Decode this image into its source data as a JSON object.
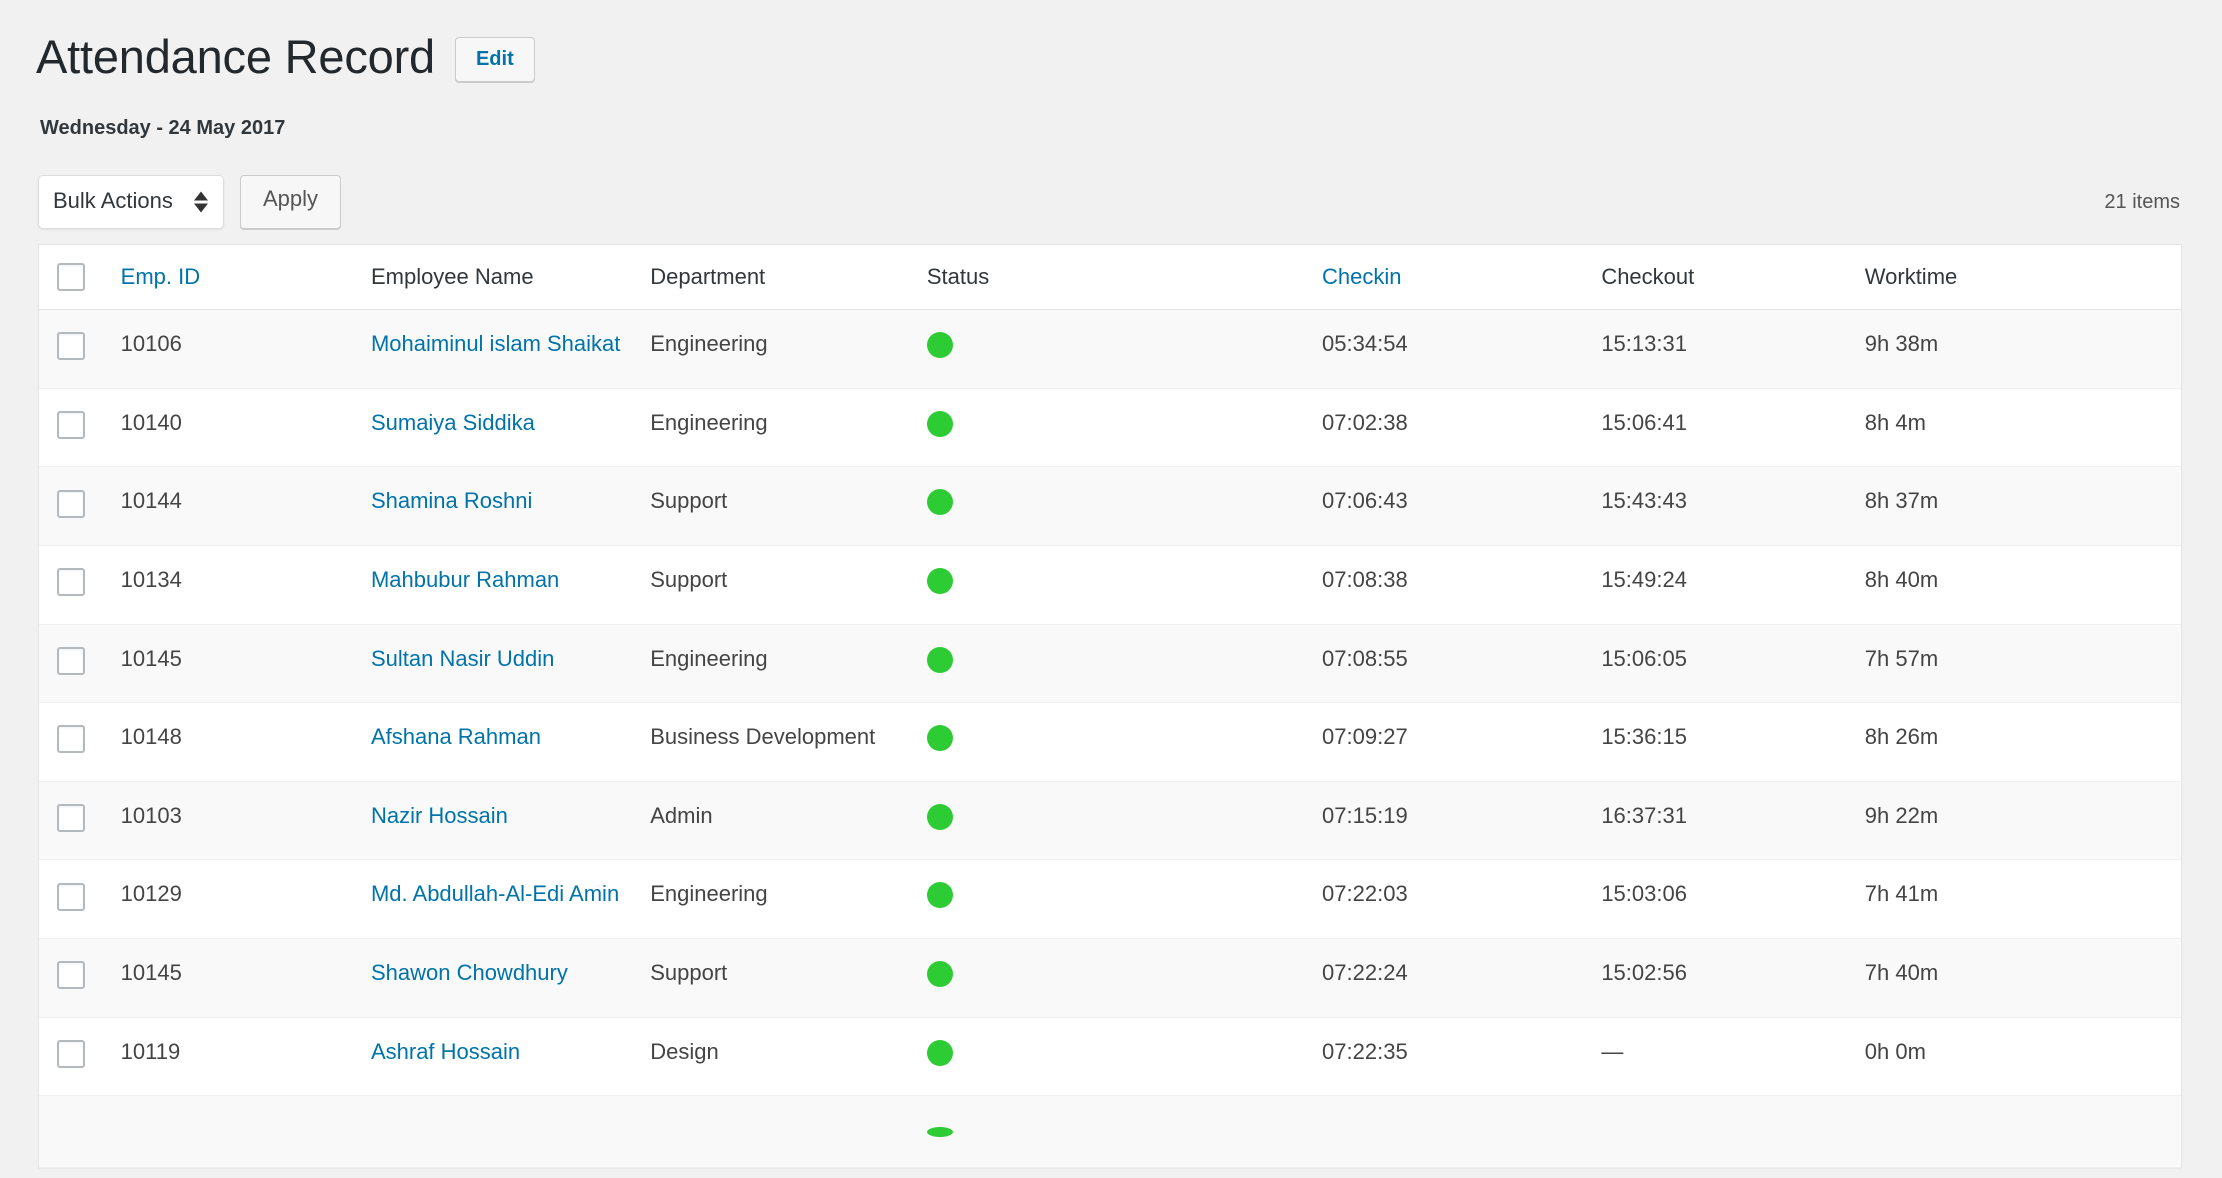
{
  "header": {
    "title": "Attendance Record",
    "edit_label": "Edit",
    "date_line": "Wednesday - 24 May 2017"
  },
  "toolbar": {
    "bulk_actions_label": "Bulk Actions",
    "bulk_actions_options": [
      "Bulk Actions"
    ],
    "apply_label": "Apply",
    "items_count": "21 items"
  },
  "table": {
    "columns": [
      {
        "key": "cb",
        "label": "",
        "link": false
      },
      {
        "key": "id",
        "label": "Emp. ID",
        "link": true
      },
      {
        "key": "name",
        "label": "Employee Name",
        "link": false
      },
      {
        "key": "dept",
        "label": "Department",
        "link": false
      },
      {
        "key": "status",
        "label": "Status",
        "link": false
      },
      {
        "key": "in",
        "label": "Checkin",
        "link": true
      },
      {
        "key": "out",
        "label": "Checkout",
        "link": false
      },
      {
        "key": "work",
        "label": "Worktime",
        "link": false
      }
    ],
    "rows": [
      {
        "id": "10106",
        "name": "Mohaiminul islam Shaikat",
        "dept": "Engineering",
        "status": "present",
        "in": "05:34:54",
        "out": "15:13:31",
        "work": "9h 38m"
      },
      {
        "id": "10140",
        "name": "Sumaiya Siddika",
        "dept": "Engineering",
        "status": "present",
        "in": "07:02:38",
        "out": "15:06:41",
        "work": "8h 4m"
      },
      {
        "id": "10144",
        "name": "Shamina Roshni",
        "dept": "Support",
        "status": "present",
        "in": "07:06:43",
        "out": "15:43:43",
        "work": "8h 37m"
      },
      {
        "id": "10134",
        "name": "Mahbubur Rahman",
        "dept": "Support",
        "status": "present",
        "in": "07:08:38",
        "out": "15:49:24",
        "work": "8h 40m"
      },
      {
        "id": "10145",
        "name": "Sultan Nasir Uddin",
        "dept": "Engineering",
        "status": "present",
        "in": "07:08:55",
        "out": "15:06:05",
        "work": "7h 57m"
      },
      {
        "id": "10148",
        "name": "Afshana Rahman",
        "dept": "Business Development",
        "status": "present",
        "in": "07:09:27",
        "out": "15:36:15",
        "work": "8h 26m"
      },
      {
        "id": "10103",
        "name": "Nazir Hossain",
        "dept": "Admin",
        "status": "present",
        "in": "07:15:19",
        "out": "16:37:31",
        "work": "9h 22m"
      },
      {
        "id": "10129",
        "name": "Md. Abdullah-Al-Edi Amin",
        "dept": "Engineering",
        "status": "present",
        "in": "07:22:03",
        "out": "15:03:06",
        "work": "7h 41m"
      },
      {
        "id": "10145",
        "name": "Shawon Chowdhury",
        "dept": "Support",
        "status": "present",
        "in": "07:22:24",
        "out": "15:02:56",
        "work": "7h 40m"
      },
      {
        "id": "10119",
        "name": "Ashraf Hossain",
        "dept": "Design",
        "status": "present",
        "in": "07:22:35",
        "out": "—",
        "work": "0h 0m"
      }
    ]
  },
  "colors": {
    "accent_link": "#0073aa",
    "status_present": "#2dcc34",
    "page_background": "#f1f1f1",
    "row_alt_background": "#f9f9f9"
  }
}
